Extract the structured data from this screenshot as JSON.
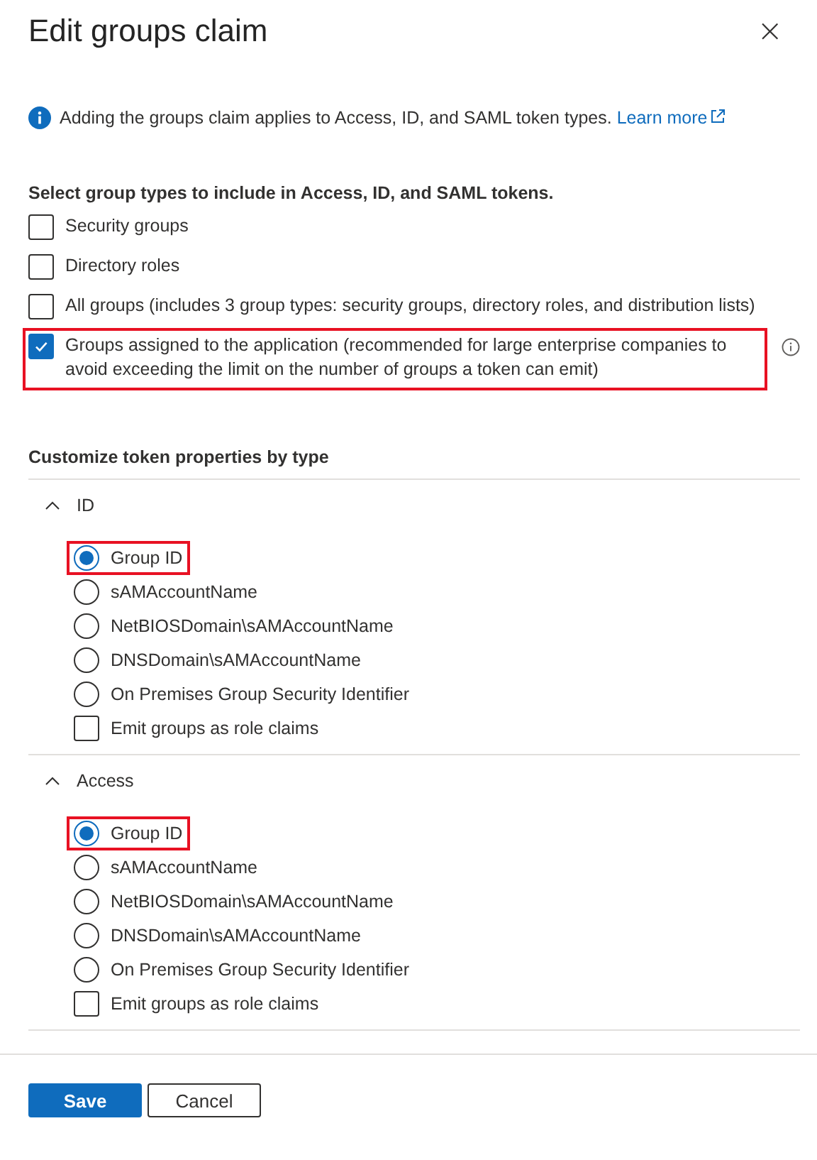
{
  "window": {
    "title": "Edit groups claim",
    "close": "×"
  },
  "info": {
    "text": "Adding the groups claim applies to Access, ID, and SAML token types.",
    "link": "Learn more"
  },
  "group_types": {
    "heading": "Select group types to include in Access, ID, and SAML tokens.",
    "options": [
      {
        "label": "Security groups",
        "checked": false,
        "highlighted": false,
        "info": false
      },
      {
        "label": "Directory roles",
        "checked": false,
        "highlighted": false,
        "info": false
      },
      {
        "label": "All groups (includes 3 group types: security groups, directory roles, and distribution lists)",
        "checked": false,
        "highlighted": false,
        "info": false
      },
      {
        "label": "Groups assigned to the application (recommended for large enterprise companies to avoid exceeding the limit on the number of groups a token can emit)",
        "checked": true,
        "highlighted": true,
        "info": true
      }
    ]
  },
  "token_properties": {
    "heading": "Customize token properties by type",
    "sections": [
      {
        "title": "ID",
        "expanded": true,
        "items": [
          {
            "kind": "radio",
            "label": "Group ID",
            "selected": true,
            "highlighted": true
          },
          {
            "kind": "radio",
            "label": "sAMAccountName",
            "selected": false,
            "highlighted": false
          },
          {
            "kind": "radio",
            "label": "NetBIOSDomain\\sAMAccountName",
            "selected": false,
            "highlighted": false
          },
          {
            "kind": "radio",
            "label": "DNSDomain\\sAMAccountName",
            "selected": false,
            "highlighted": false
          },
          {
            "kind": "radio",
            "label": "On Premises Group Security Identifier",
            "selected": false,
            "highlighted": false
          },
          {
            "kind": "checkbox",
            "label": "Emit groups as role claims",
            "checked": false,
            "highlighted": false
          }
        ]
      },
      {
        "title": "Access",
        "expanded": true,
        "items": [
          {
            "kind": "radio",
            "label": "Group ID",
            "selected": true,
            "highlighted": true
          },
          {
            "kind": "radio",
            "label": "sAMAccountName",
            "selected": false,
            "highlighted": false
          },
          {
            "kind": "radio",
            "label": "NetBIOSDomain\\sAMAccountName",
            "selected": false,
            "highlighted": false
          },
          {
            "kind": "radio",
            "label": "DNSDomain\\sAMAccountName",
            "selected": false,
            "highlighted": false
          },
          {
            "kind": "radio",
            "label": "On Premises Group Security Identifier",
            "selected": false,
            "highlighted": false
          },
          {
            "kind": "checkbox",
            "label": "Emit groups as role claims",
            "checked": false,
            "highlighted": false
          }
        ]
      }
    ]
  },
  "buttons": [
    {
      "label": "Save",
      "kind": "primary"
    },
    {
      "label": "Cancel",
      "kind": "secondary"
    }
  ]
}
